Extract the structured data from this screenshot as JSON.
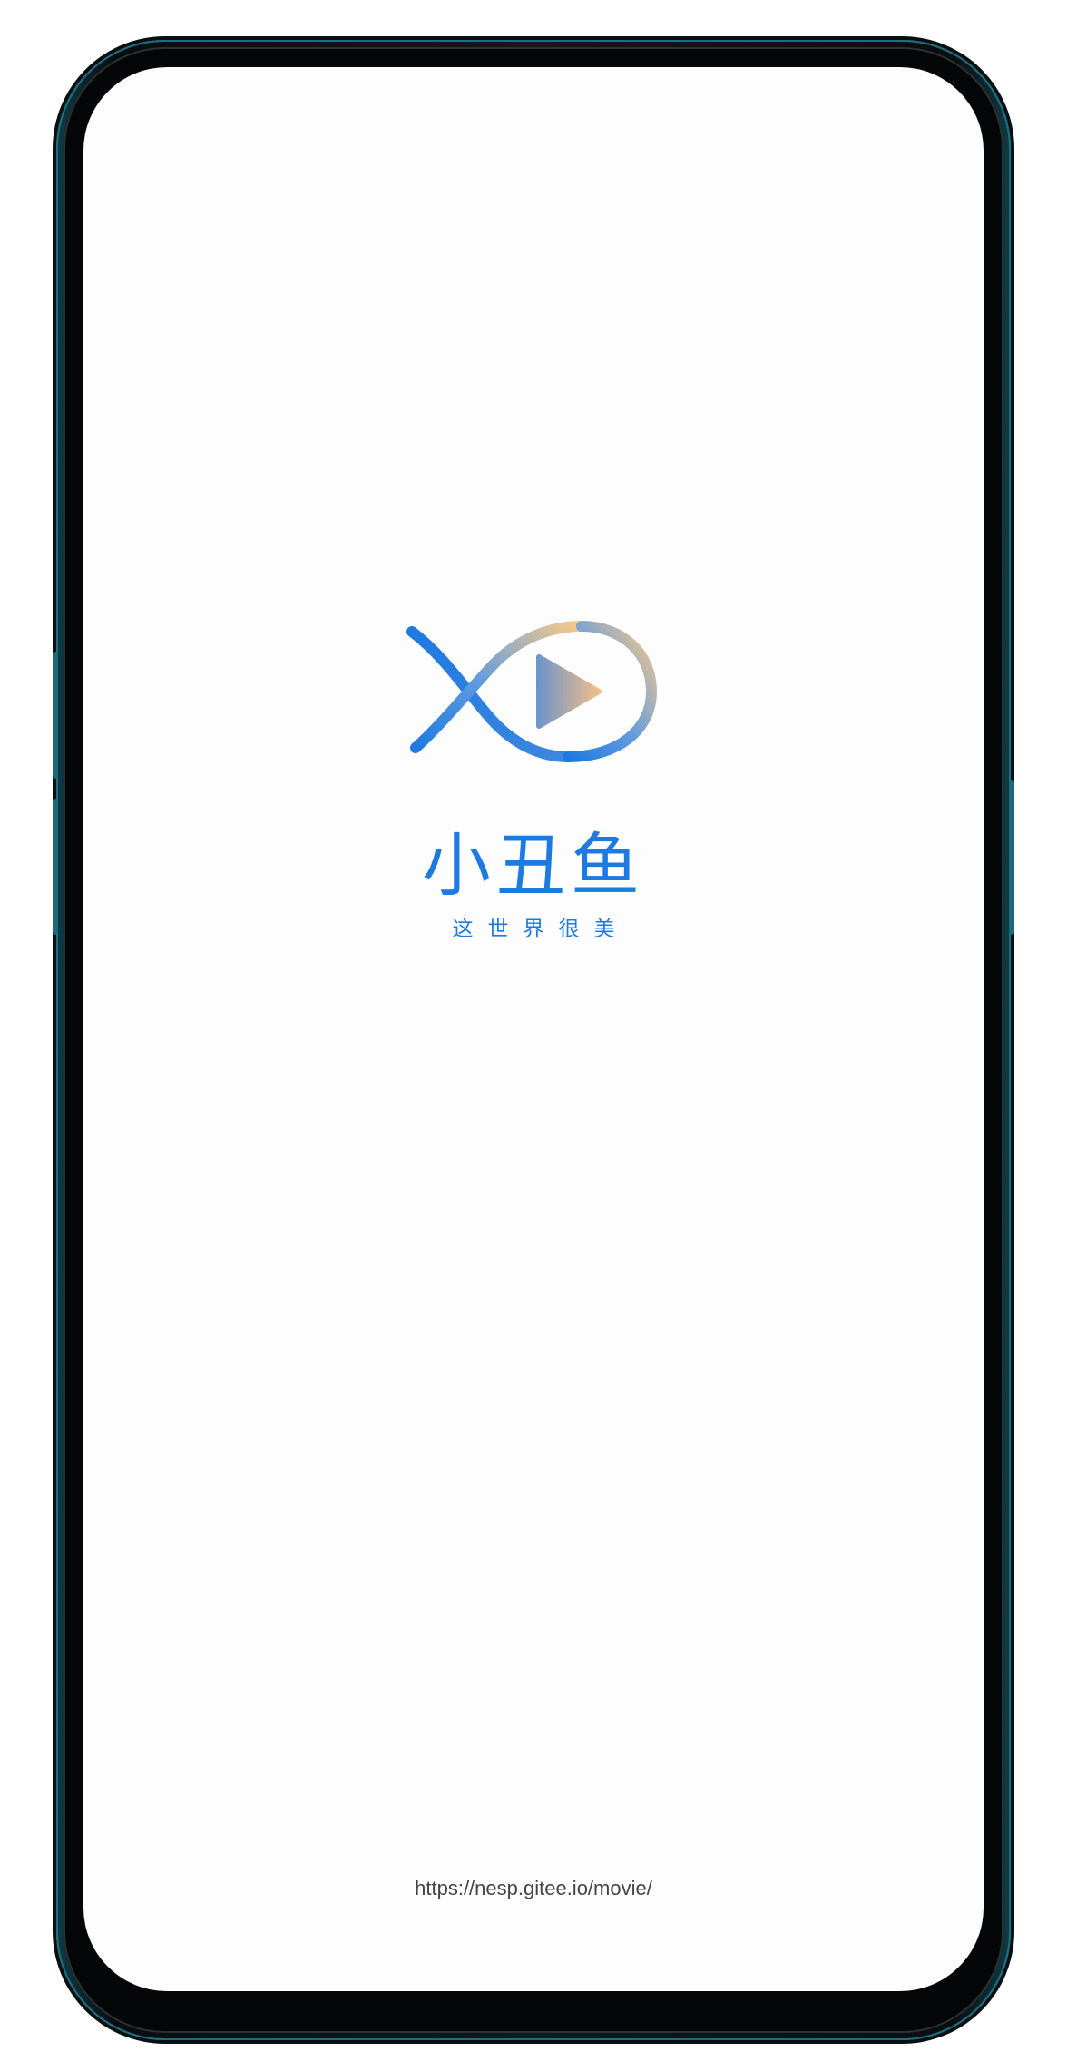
{
  "app": {
    "name": "小丑鱼",
    "slogan": "这世界很美",
    "url": "https://nesp.gitee.io/movie/"
  },
  "logo": {
    "icon": "clownfish-play-logo",
    "colors": {
      "blue": "#1f7ae0",
      "orange": "#f7c98b"
    }
  },
  "theme": {
    "accent": "#1f7ae0",
    "background": "#fdfdfd"
  }
}
